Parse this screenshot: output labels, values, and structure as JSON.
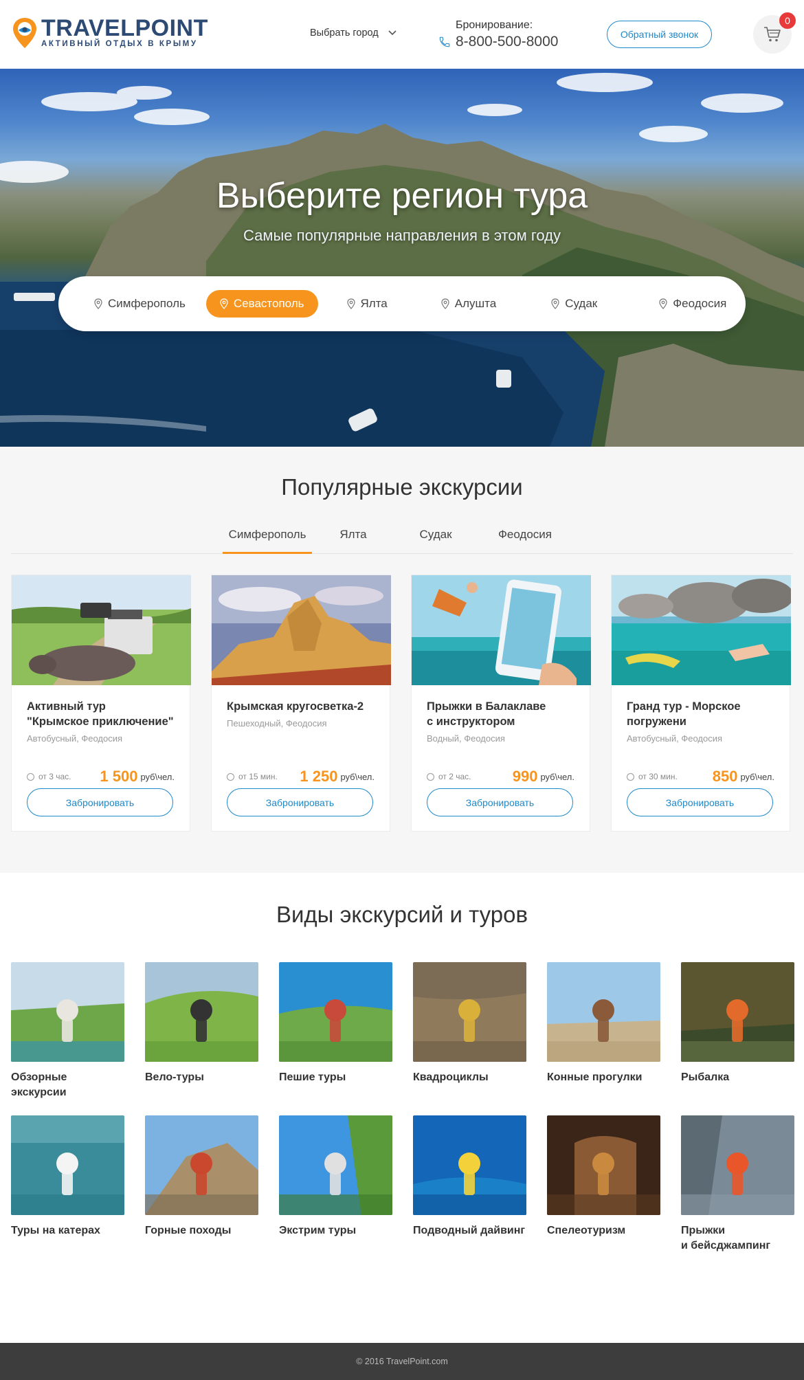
{
  "header": {
    "logo_name": "TRAVELPOINT",
    "logo_tagline": "АКТИВНЫЙ ОТДЫХ В КРЫМУ",
    "city_select": "Выбрать город",
    "booking_label": "Бронирование:",
    "booking_phone": "8-800-500-8000",
    "callback_button": "Обратный звонок",
    "cart_count": "0"
  },
  "hero": {
    "title": "Выберите регион тура",
    "subtitle": "Самые популярные направления в этом году",
    "regions": [
      {
        "label": "Симферополь",
        "active": false
      },
      {
        "label": "Севастополь",
        "active": true
      },
      {
        "label": "Ялта",
        "active": false
      },
      {
        "label": "Алушта",
        "active": false
      },
      {
        "label": "Судак",
        "active": false
      },
      {
        "label": "Феодосия",
        "active": false
      }
    ]
  },
  "popular": {
    "title": "Популярные экскурсии",
    "tabs": [
      {
        "label": "Симферополь",
        "active": true
      },
      {
        "label": "Ялта",
        "active": false
      },
      {
        "label": "Судак",
        "active": false
      },
      {
        "label": "Феодосия",
        "active": false
      }
    ],
    "cards": [
      {
        "title_line1": "Активный тур",
        "title_line2": "\"Крымское приключение\"",
        "meta": "Автобусный, Феодосия",
        "duration": "от 3 час.",
        "price": "1 500",
        "unit": "руб\\чел.",
        "button": "Забронировать"
      },
      {
        "title_line1": "Крымская кругосветка-2",
        "title_line2": "",
        "meta": "Пешеходный, Феодосия",
        "duration": "от 15 мин.",
        "price": "1 250",
        "unit": "руб\\чел.",
        "button": "Забронировать"
      },
      {
        "title_line1": "Прыжки в Балаклаве",
        "title_line2": "с инструктором",
        "meta": "Водный, Феодосия",
        "duration": "от 2 час.",
        "price": "990",
        "unit": "руб\\чел.",
        "button": "Забронировать"
      },
      {
        "title_line1": "Гранд тур - Морское",
        "title_line2": "погружени",
        "meta": "Автобусный, Феодосия",
        "duration": "от 30 мин.",
        "price": "850",
        "unit": "руб\\чел.",
        "button": "Забронировать"
      }
    ]
  },
  "types": {
    "title": "Виды экскурсий и туров",
    "items": [
      {
        "line1": "Обзорные",
        "line2": "экскурсии"
      },
      {
        "line1": "Вело-туры",
        "line2": ""
      },
      {
        "line1": "Пешие туры",
        "line2": ""
      },
      {
        "line1": "Квадроциклы",
        "line2": ""
      },
      {
        "line1": "Конные прогулки",
        "line2": ""
      },
      {
        "line1": "Рыбалка",
        "line2": ""
      },
      {
        "line1": "Туры на катерах",
        "line2": ""
      },
      {
        "line1": "Горные походы",
        "line2": ""
      },
      {
        "line1": "Экстрим туры",
        "line2": ""
      },
      {
        "line1": "Подводный дайвинг",
        "line2": ""
      },
      {
        "line1": "Спелеотуризм",
        "line2": ""
      },
      {
        "line1": "Прыжки",
        "line2": "и бейсджампинг"
      }
    ]
  },
  "footer": {
    "copyright": "© 2016 TravelPoint.com"
  },
  "colors": {
    "accent": "#f7941d",
    "link_blue": "#1e88c9",
    "brand_navy": "#2c4a74",
    "badge_red": "#e83a3a",
    "footer_bg": "#3d3d3d"
  }
}
